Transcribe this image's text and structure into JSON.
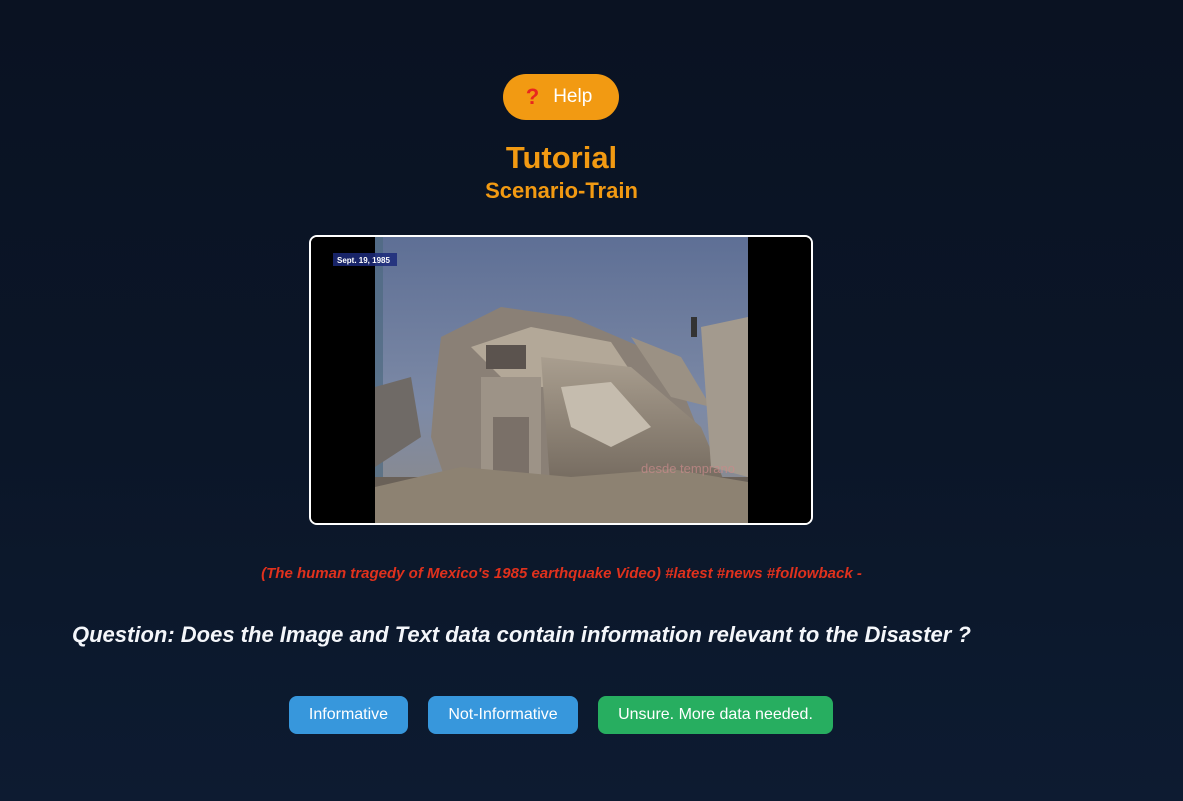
{
  "help": {
    "icon": "question-mark-icon",
    "label": "Help"
  },
  "header": {
    "title": "Tutorial",
    "subtitle": "Scenario-Train"
  },
  "media": {
    "overlay_date": "Sept. 19, 1985",
    "overlay_watermark": "desde temprano"
  },
  "caption": "(The human tragedy of Mexico's 1985 earthquake Video) #latest #news #followback -",
  "question": "Question: Does the Image and Text data contain information relevant to the Disaster ?",
  "answers": {
    "informative": "Informative",
    "not_informative": "Not-Informative",
    "unsure": "Unsure. More data needed."
  },
  "colors": {
    "accent": "#f29a12",
    "caption": "#e0311d",
    "button_blue": "#3797dc",
    "button_green": "#27ae60",
    "background": "#0b1628"
  }
}
